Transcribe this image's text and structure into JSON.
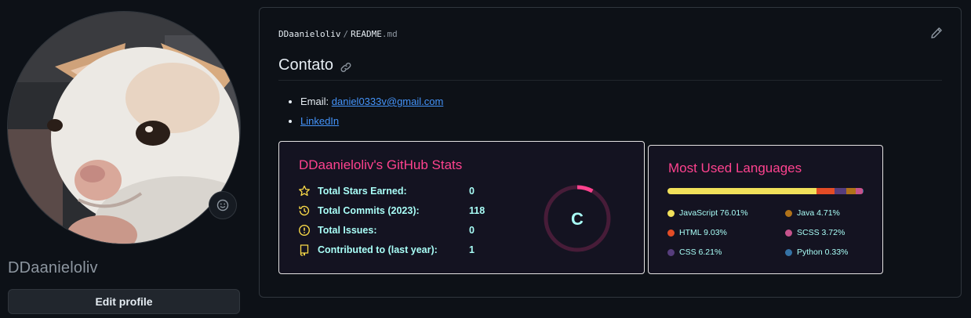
{
  "profile": {
    "username": "DDaanieloliv",
    "edit_label": "Edit profile"
  },
  "readme": {
    "owner": "DDaanieloliv",
    "separator": "/",
    "file_name": "README",
    "file_ext": ".md",
    "heading": "Contato",
    "email_label": "Email:",
    "email": "daniel0333v@gmail.com",
    "linkedin": "LinkedIn"
  },
  "colors": {
    "title": "#fe428e",
    "text": "#a9fef7",
    "icon": "#f8d847",
    "card_bg": "#141321",
    "link": "#4493f8"
  },
  "stats": {
    "title": "DDaanieloliv's GitHub Stats",
    "rank": "C",
    "rank_progress_percent": 8,
    "rows": [
      {
        "label": "Total Stars Earned:",
        "value": "0",
        "icon": "star-icon"
      },
      {
        "label": "Total Commits (2023):",
        "value": "118",
        "icon": "history-icon"
      },
      {
        "label": "Total Issues:",
        "value": "0",
        "icon": "issue-icon"
      },
      {
        "label": "Contributed to (last year):",
        "value": "1",
        "icon": "repo-icon"
      }
    ]
  },
  "languages": {
    "title": "Most Used Languages",
    "items": [
      {
        "name": "JavaScript",
        "percent": 76.01,
        "label": "JavaScript 76.01%",
        "color": "#f1e05a"
      },
      {
        "name": "HTML",
        "percent": 9.03,
        "label": "HTML 9.03%",
        "color": "#e34c26"
      },
      {
        "name": "CSS",
        "percent": 6.21,
        "label": "CSS 6.21%",
        "color": "#563d7c"
      },
      {
        "name": "Java",
        "percent": 4.71,
        "label": "Java 4.71%",
        "color": "#b07219"
      },
      {
        "name": "SCSS",
        "percent": 3.72,
        "label": "SCSS 3.72%",
        "color": "#c6538c"
      },
      {
        "name": "Python",
        "percent": 0.33,
        "label": "Python 0.33%",
        "color": "#3572a5"
      }
    ]
  }
}
